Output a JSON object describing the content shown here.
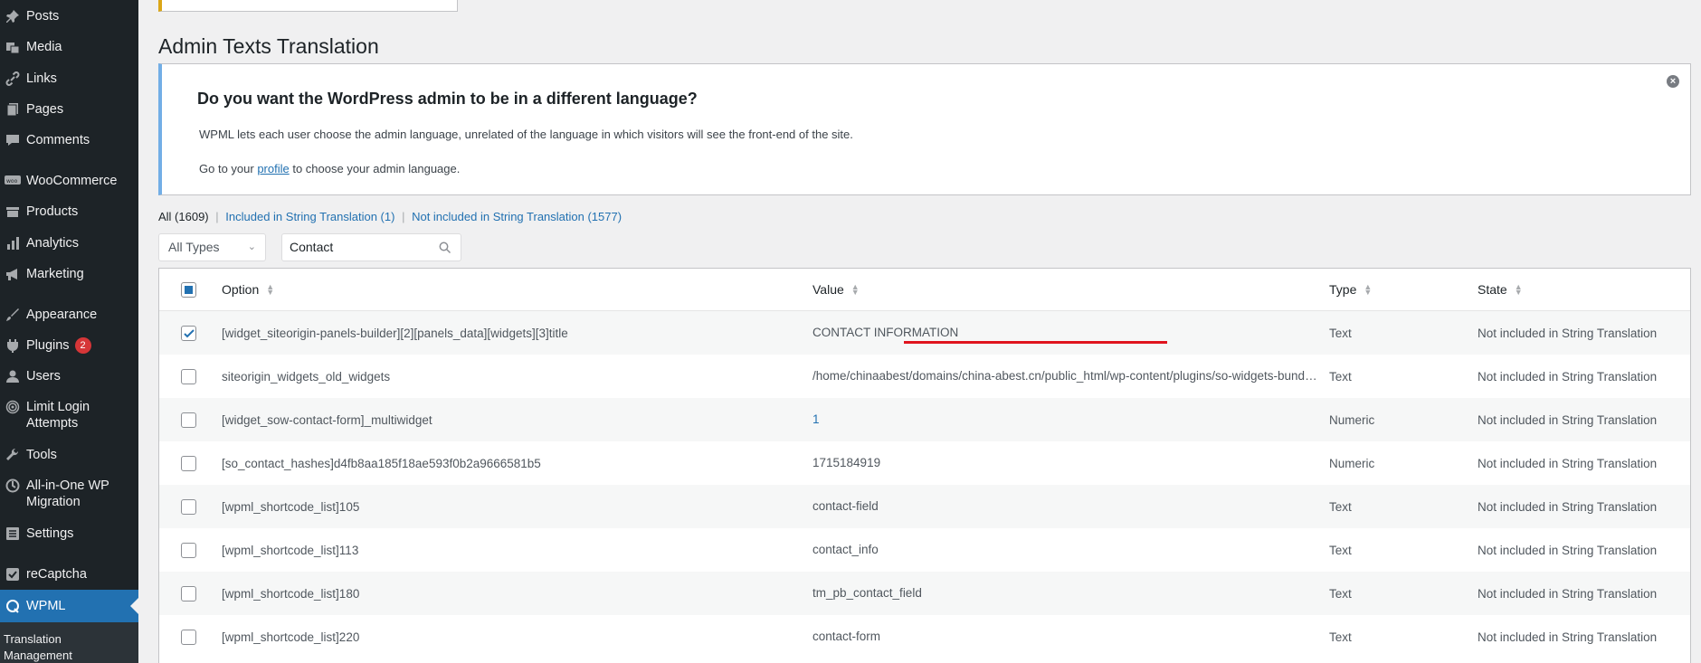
{
  "sidebar": {
    "items": [
      {
        "label": "Posts",
        "icon": "pin-icon"
      },
      {
        "label": "Media",
        "icon": "media-icon"
      },
      {
        "label": "Links",
        "icon": "link-icon"
      },
      {
        "label": "Pages",
        "icon": "pages-icon"
      },
      {
        "label": "Comments",
        "icon": "comment-icon"
      },
      {
        "label": "WooCommerce",
        "icon": "woo-icon"
      },
      {
        "label": "Products",
        "icon": "products-icon"
      },
      {
        "label": "Analytics",
        "icon": "analytics-icon"
      },
      {
        "label": "Marketing",
        "icon": "megaphone-icon"
      },
      {
        "label": "Appearance",
        "icon": "brush-icon"
      },
      {
        "label": "Plugins",
        "icon": "plugin-icon",
        "badge": "2"
      },
      {
        "label": "Users",
        "icon": "user-icon"
      },
      {
        "label": "Limit Login Attempts",
        "icon": "fingerprint-icon"
      },
      {
        "label": "Tools",
        "icon": "wrench-icon"
      },
      {
        "label": "All-in-One WP Migration",
        "icon": "migration-icon"
      },
      {
        "label": "Settings",
        "icon": "settings-icon"
      },
      {
        "label": "reCaptcha",
        "icon": "check-icon"
      },
      {
        "label": "WPML",
        "icon": "wpml-icon",
        "active": true
      }
    ],
    "submenu_label": "Translation Management"
  },
  "page": {
    "title": "Admin Texts Translation"
  },
  "notice": {
    "title": "Do you want the WordPress admin to be in a different language?",
    "text": "WPML lets each user choose the admin language, unrelated of the language in which visitors will see the front-end of the site.",
    "cta_prefix": "Go to your ",
    "cta_link": "profile",
    "cta_suffix": " to choose your admin language.",
    "dismiss": "×"
  },
  "filters": {
    "all": "All (1609)",
    "included": "Included in String Translation (1)",
    "not_included": "Not included in String Translation (1577)",
    "sep": "|"
  },
  "type_select": {
    "value": "All Types"
  },
  "search": {
    "value": "Contact"
  },
  "table": {
    "headers": {
      "option": "Option",
      "value": "Value",
      "type": "Type",
      "state": "State"
    },
    "rows": [
      {
        "option": "[widget_siteorigin-panels-builder][2][panels_data][widgets][3]title",
        "value": "CONTACT INFORMATION",
        "type": "Text",
        "state": "Not included in String Translation",
        "checked": true
      },
      {
        "option": "siteorigin_widgets_old_widgets",
        "value": "/home/chinaabest/domains/china-abest.cn/public_html/wp-content/plugins/so-widgets-bundle/widgets/contact/contact.php",
        "type": "Text",
        "state": "Not included in String Translation"
      },
      {
        "option": "[widget_sow-contact-form]_multiwidget",
        "value": "1",
        "type": "Numeric",
        "state": "Not included in String Translation",
        "link": true
      },
      {
        "option": "[so_contact_hashes]d4fb8aa185f18ae593f0b2a9666581b5",
        "value": "1715184919",
        "type": "Numeric",
        "state": "Not included in String Translation"
      },
      {
        "option": "[wpml_shortcode_list]105",
        "value": "contact-field",
        "type": "Text",
        "state": "Not included in String Translation"
      },
      {
        "option": "[wpml_shortcode_list]113",
        "value": "contact_info",
        "type": "Text",
        "state": "Not included in String Translation"
      },
      {
        "option": "[wpml_shortcode_list]180",
        "value": "tm_pb_contact_field",
        "type": "Text",
        "state": "Not included in String Translation"
      },
      {
        "option": "[wpml_shortcode_list]220",
        "value": "contact-form",
        "type": "Text",
        "state": "Not included in String Translation"
      }
    ]
  },
  "colors": {
    "sidebar_bg": "#1d2327",
    "active_bg": "#2271b1",
    "link": "#2271b1",
    "annotation": "#e0141e"
  }
}
